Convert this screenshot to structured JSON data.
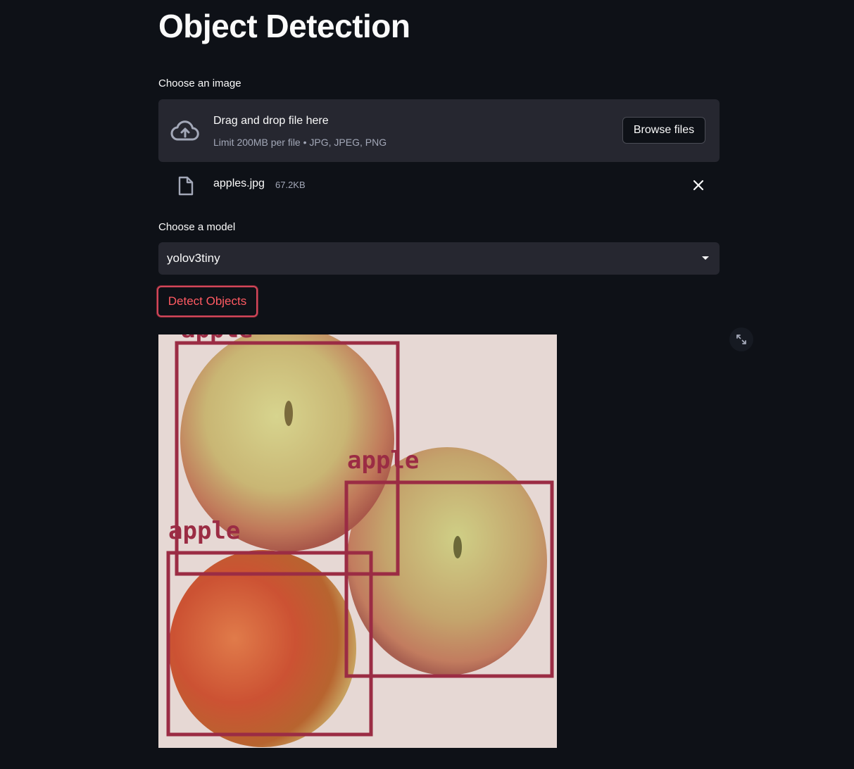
{
  "page": {
    "title": "Object Detection"
  },
  "uploader": {
    "label": "Choose an image",
    "drop_title": "Drag and drop file here",
    "drop_subtitle": "Limit 200MB per file • JPG, JPEG, PNG",
    "browse_label": "Browse files",
    "icon": "cloud-upload-icon"
  },
  "uploaded_file": {
    "name": "apples.jpg",
    "size": "67.2KB",
    "icon": "file-icon",
    "remove_icon": "close-icon"
  },
  "model_select": {
    "label": "Choose a model",
    "value": "yolov3tiny"
  },
  "detect_button": {
    "label": "Detect Objects"
  },
  "result": {
    "detections": [
      {
        "label": "apple"
      },
      {
        "label": "apple"
      },
      {
        "label": "apple"
      }
    ],
    "box_color": "#9b2c44"
  },
  "colors": {
    "background": "#0e1117",
    "surface": "#262730",
    "text": "#fafafa",
    "muted": "#a3a8b8",
    "accent": "#ff4b4b"
  }
}
